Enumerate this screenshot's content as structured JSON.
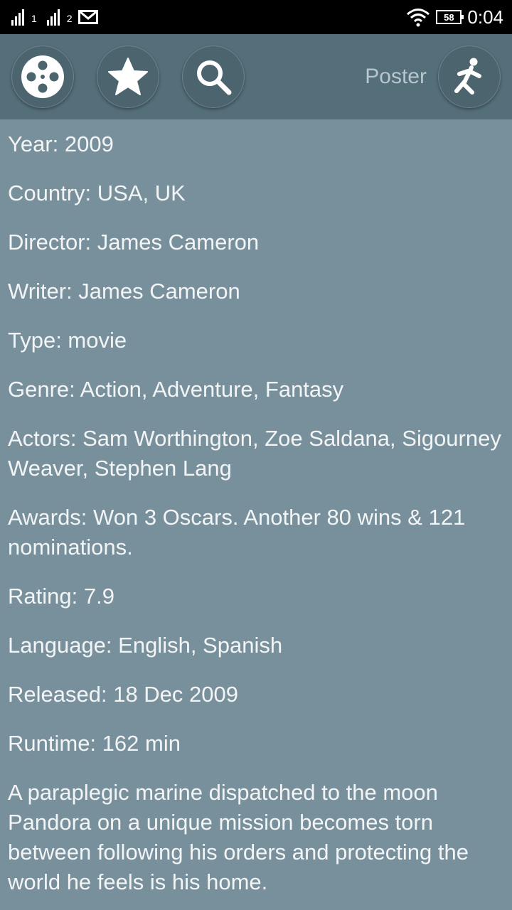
{
  "status_bar": {
    "sim1": "1",
    "sim2": "2",
    "battery": "58",
    "time": "0:04",
    "icons": [
      "signal-icon",
      "mail-icon",
      "wifi-icon",
      "battery-icon"
    ]
  },
  "toolbar": {
    "film_icon": "film-reel-icon",
    "favorite_icon": "star-icon",
    "search_icon": "search-icon",
    "poster_label": "Poster",
    "poster_icon": "running-man-icon"
  },
  "movie": {
    "year": "Year: 2009",
    "country": "Country: USA, UK",
    "director": "Director: James Cameron",
    "writer": "Writer: James Cameron",
    "type": "Type: movie",
    "genre": "Genre: Action, Adventure, Fantasy",
    "actors": "Actors: Sam Worthington, Zoe Saldana, Sigourney Weaver, Stephen Lang",
    "awards": "Awards: Won 3 Oscars. Another 80 wins & 121 nominations.",
    "rating": "Rating: 7.9",
    "language": "Language: English, Spanish",
    "released": "Released: 18 Dec 2009",
    "runtime": "Runtime: 162 min",
    "plot": "A paraplegic marine dispatched to the moon Pandora on a unique mission becomes torn between following his orders and protecting the world he feels is his home."
  },
  "colors": {
    "background": "#78909c",
    "toolbar": "#546e7a",
    "status_bar": "#000000",
    "text": "#f2f4f5"
  }
}
